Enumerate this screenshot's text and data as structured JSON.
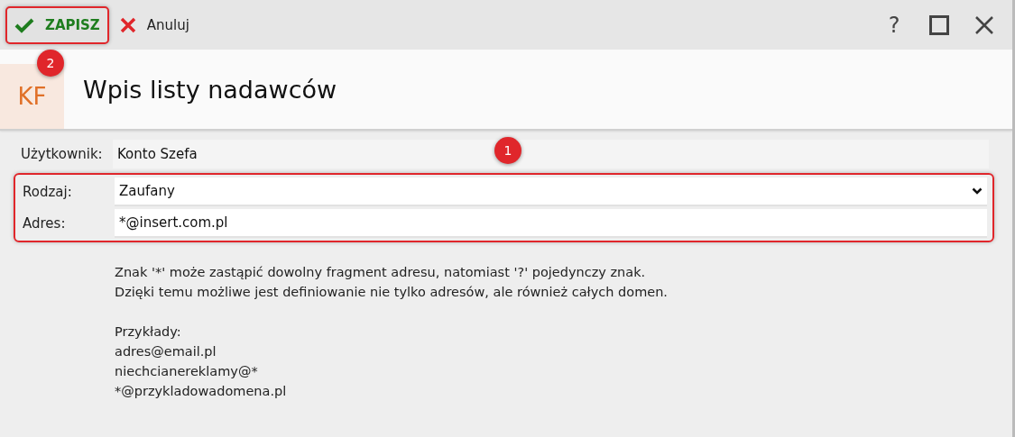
{
  "toolbar": {
    "buttons": [
      {
        "kind": "save",
        "label": "ZAPISZ",
        "badge": "2"
      },
      {
        "kind": "cancel",
        "label": "Anuluj"
      }
    ],
    "window_controls": [
      {
        "kind": "help",
        "label": "?"
      },
      {
        "kind": "maximize"
      },
      {
        "kind": "close"
      }
    ]
  },
  "header": {
    "logo": "KF",
    "title": "Wpis listy nadawców"
  },
  "form": {
    "badge": "1",
    "fields": [
      {
        "kind": "readonly",
        "label": "Użytkownik:",
        "value": "Konto Szefa"
      },
      {
        "kind": "select",
        "label": "Rodzaj:",
        "value": "Zaufany"
      },
      {
        "kind": "input",
        "label": "Adres:",
        "value": "*@insert.com.pl"
      }
    ]
  },
  "help": {
    "paragraphs": [
      [
        "Znak '*' może zastąpić dowolny fragment adresu, natomiast '?' pojedynczy znak.",
        "Dzięki temu możliwe jest definiowanie nie tylko adresów, ale również całych domen."
      ],
      [
        "Przykłady:",
        "adres@email.pl",
        "niechcianereklamy@*",
        "*@przykladowadomena.pl"
      ]
    ]
  }
}
